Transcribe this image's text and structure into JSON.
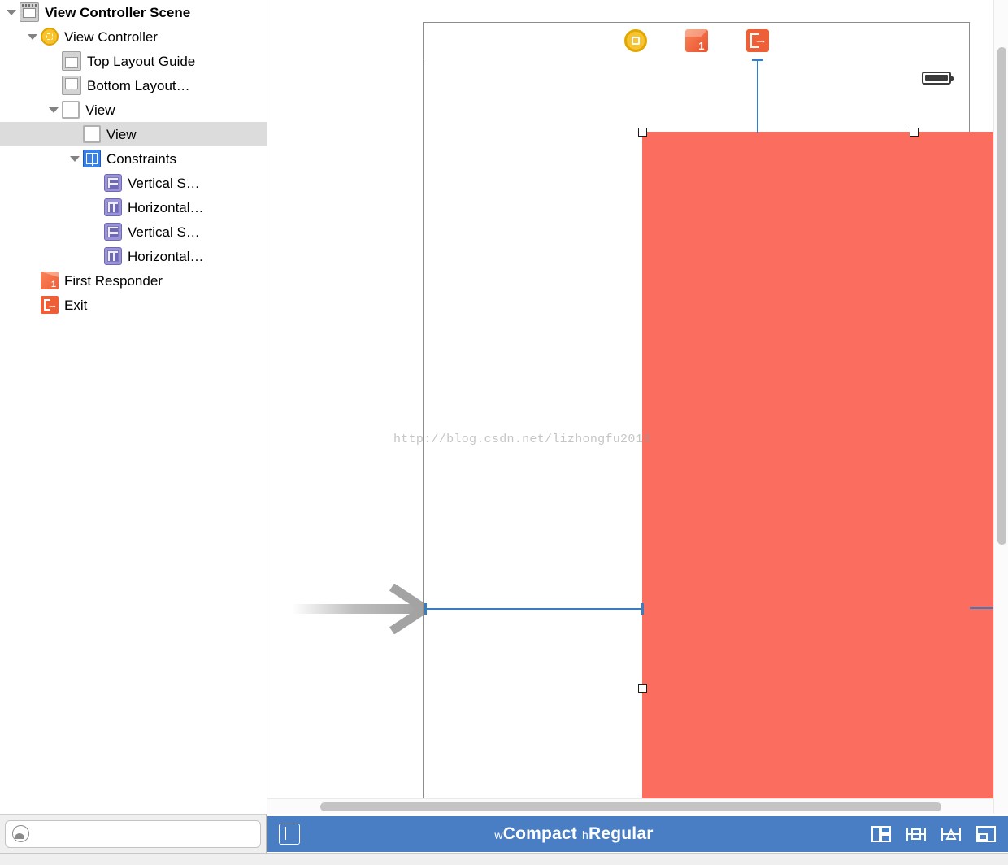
{
  "outline": {
    "rows": [
      {
        "label": "View Controller Scene",
        "icon": "storyboard-scene-icon",
        "indent": 0,
        "disclosure": "open",
        "bold": true,
        "selected": false
      },
      {
        "label": "View Controller",
        "icon": "view-controller-icon",
        "indent": 1,
        "disclosure": "open",
        "bold": false,
        "selected": false
      },
      {
        "label": "Top Layout Guide",
        "icon": "top-layout-guide-icon",
        "indent": 2,
        "disclosure": "none",
        "bold": false,
        "selected": false
      },
      {
        "label": "Bottom Layout…",
        "icon": "bottom-layout-guide-icon",
        "indent": 2,
        "disclosure": "none",
        "bold": false,
        "selected": false
      },
      {
        "label": "View",
        "icon": "view-icon",
        "indent": 2,
        "disclosure": "open",
        "bold": false,
        "selected": false
      },
      {
        "label": "View",
        "icon": "view-icon",
        "indent": 3,
        "disclosure": "none",
        "bold": false,
        "selected": true
      },
      {
        "label": "Constraints",
        "icon": "constraints-folder-icon",
        "indent": 3,
        "disclosure": "open",
        "bold": false,
        "selected": false
      },
      {
        "label": "Vertical S…",
        "icon": "vertical-space-constraint-icon",
        "indent": 4,
        "disclosure": "none",
        "bold": false,
        "selected": false
      },
      {
        "label": "Horizontal…",
        "icon": "horizontal-space-constraint-icon",
        "indent": 4,
        "disclosure": "none",
        "bold": false,
        "selected": false
      },
      {
        "label": "Vertical S…",
        "icon": "vertical-space-constraint-icon",
        "indent": 4,
        "disclosure": "none",
        "bold": false,
        "selected": false
      },
      {
        "label": "Horizontal…",
        "icon": "horizontal-space-constraint-icon",
        "indent": 4,
        "disclosure": "none",
        "bold": false,
        "selected": false
      },
      {
        "label": "First Responder",
        "icon": "first-responder-icon",
        "indent": 1,
        "disclosure": "none",
        "bold": false,
        "selected": false
      },
      {
        "label": "Exit",
        "icon": "exit-icon",
        "indent": 1,
        "disclosure": "none",
        "bold": false,
        "selected": false
      }
    ]
  },
  "filter": {
    "value": "",
    "placeholder": "",
    "icon": "filter-icon"
  },
  "canvas": {
    "scene_icons": [
      {
        "name": "view-controller-icon",
        "title": "View Controller"
      },
      {
        "name": "first-responder-icon",
        "title": "First Responder",
        "badge": "1"
      },
      {
        "name": "exit-icon",
        "title": "Exit"
      }
    ],
    "status_bar_icon": "battery-icon",
    "subview_color": "#fb6e5f",
    "constraint_color": "#3b7cbf",
    "entry_point_icon": "storyboard-entry-point-arrow-icon",
    "watermark": "http://blog.csdn.net/lizhongfu2013"
  },
  "status_bar": {
    "panel_toggle_icon": "assistant-panel-toggle-icon",
    "size_class": {
      "width_prefix": "w",
      "width_value": "Compact",
      "height_prefix": "h",
      "height_value": "Regular"
    },
    "autolayout_tools": [
      {
        "name": "stack-button",
        "label": "Stack"
      },
      {
        "name": "align-button",
        "label": "Align"
      },
      {
        "name": "pin-button",
        "label": "Pin"
      },
      {
        "name": "resolve-issues-button",
        "label": "Resolve Auto Layout Issues"
      }
    ],
    "accent_color": "#4a7ec4"
  }
}
